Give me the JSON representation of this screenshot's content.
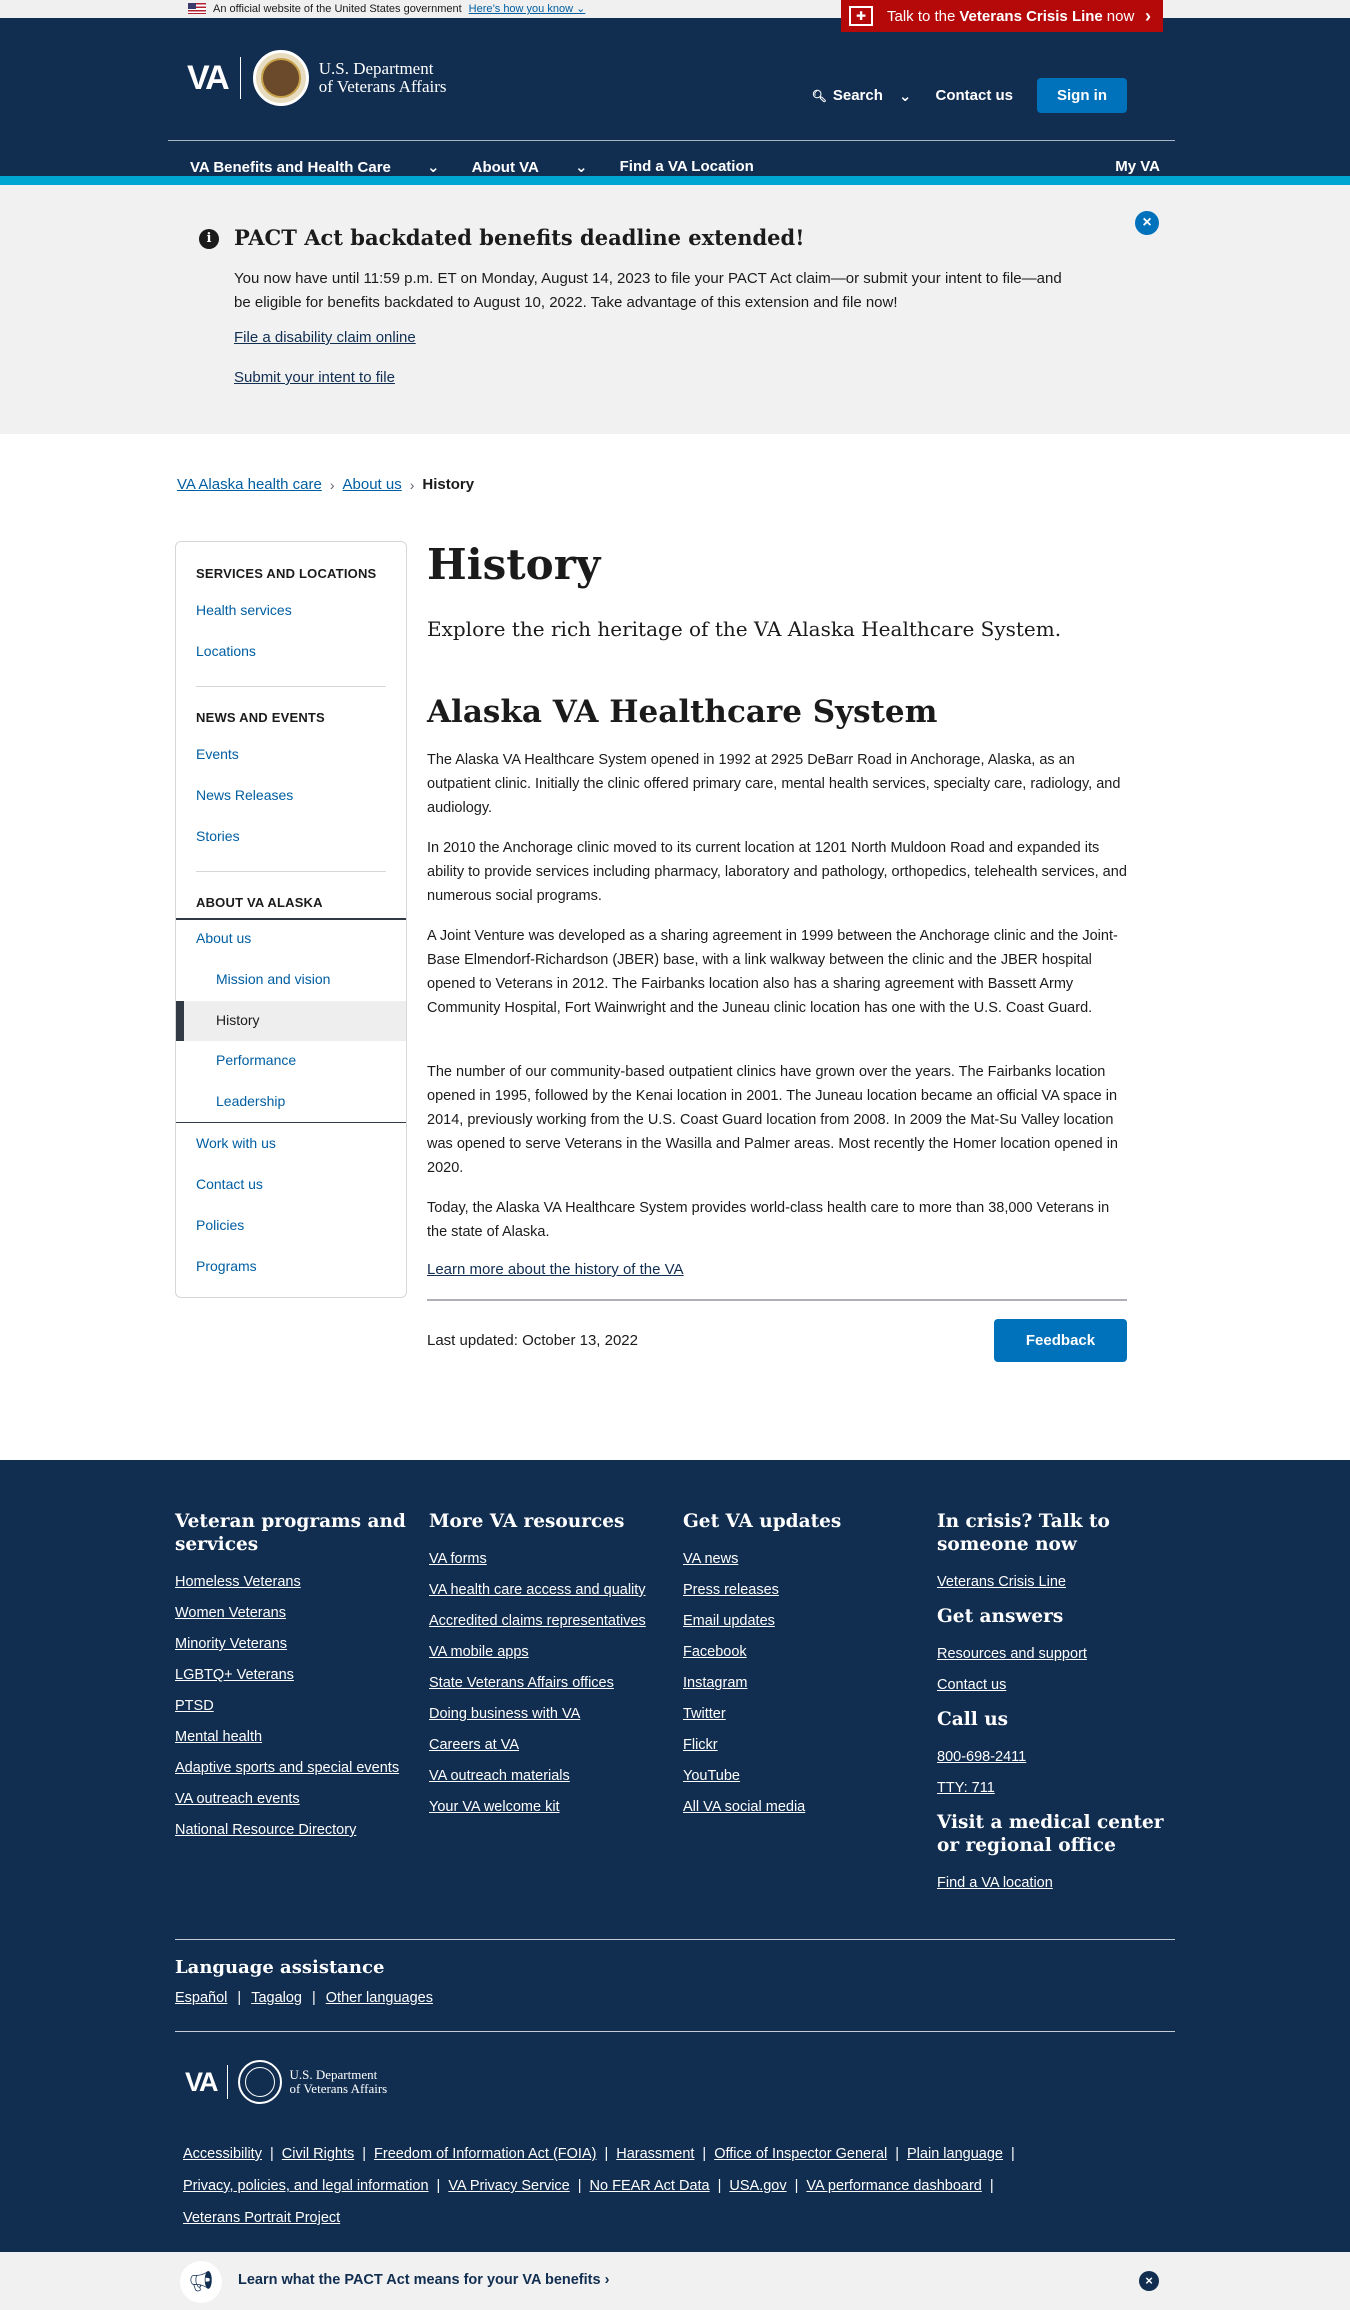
{
  "gov_banner": {
    "text": "An official website of the United States government",
    "link": "Here’s how you know"
  },
  "crisis_line": {
    "pre": "Talk to the",
    "bold": "Veterans Crisis Line",
    "post": "now"
  },
  "header": {
    "logo_text": "VA",
    "dept_line1": "U.S. Department",
    "dept_line2": "of Veterans Affairs",
    "search": "Search",
    "contact": "Contact us",
    "signin": "Sign in"
  },
  "nav": {
    "benefits": "VA Benefits and Health Care",
    "about": "About VA",
    "find": "Find a VA Location",
    "myva": "My VA"
  },
  "alert": {
    "title": "PACT Act backdated benefits deadline extended!",
    "body": "You now have until 11:59 p.m. ET on Monday, August 14, 2023 to file your PACT Act claim—or submit your intent to file—and be eligible for benefits backdated to August 10, 2022. Take advantage of this extension and file now!",
    "link1": "File a disability claim online",
    "link2": "Submit your intent to file"
  },
  "breadcrumb": {
    "c1": "VA Alaska health care",
    "c2": "About us",
    "c3": "History"
  },
  "sidebar": {
    "h1": "SERVICES AND LOCATIONS",
    "health_services": "Health services",
    "locations": "Locations",
    "h2": "NEWS AND EVENTS",
    "events": "Events",
    "news": "News Releases",
    "stories": "Stories",
    "h3": "ABOUT VA ALASKA",
    "about_us": "About us",
    "mission": "Mission and vision",
    "history": "History",
    "performance": "Performance",
    "leadership": "Leadership",
    "work": "Work with us",
    "contact": "Contact us",
    "policies": "Policies",
    "programs": "Programs"
  },
  "main": {
    "title": "History",
    "lead": "Explore the rich heritage of the VA Alaska Healthcare System.",
    "subtitle": "Alaska VA Healthcare System",
    "p1": "The Alaska VA Healthcare System opened in 1992 at 2925 DeBarr Road in Anchorage, Alaska, as an outpatient clinic. Initially the clinic offered primary care, mental health services, specialty care, radiology, and audiology.",
    "p2": "In 2010 the Anchorage clinic moved to its current location at 1201 North Muldoon Road and expanded its ability to provide services including pharmacy, laboratory and pathology, orthopedics, telehealth services, and numerous social programs.",
    "p3": "A Joint Venture was developed as a sharing agreement in 1999 between the Anchorage clinic and the Joint-Base Elmendorf-Richardson (JBER) base, with a link walkway between the clinic and the JBER hospital opened to Veterans in 2012. The Fairbanks location also has a sharing agreement with Bassett Army Community Hospital, Fort Wainwright and the Juneau clinic location has one with the U.S. Coast Guard.",
    "p4": "The number of our community-based outpatient clinics have grown over the years. The Fairbanks location opened in 1995, followed by the Kenai location in 2001. The Juneau location became an official VA space in 2014, previously working from the U.S. Coast Guard location from 2008. In 2009 the Mat-Su Valley location was opened to serve Veterans in the Wasilla and Palmer areas. Most recently the Homer location opened in 2020.",
    "p5": "Today, the Alaska VA Healthcare System provides world-class health care to more than 38,000 Veterans in the state of Alaska.",
    "learn_more": "Learn more about the history of the VA",
    "last_updated": "Last updated: October 13, 2022",
    "feedback": "Feedback"
  },
  "footer": {
    "col1_title": "Veteran programs and services",
    "col1": [
      "Homeless Veterans",
      "Women Veterans",
      "Minority Veterans",
      "LGBTQ+ Veterans",
      "PTSD",
      "Mental health",
      "Adaptive sports and special events",
      "VA outreach events",
      "National Resource Directory"
    ],
    "col2_title": "More VA resources",
    "col2": [
      "VA forms",
      "VA health care access and quality",
      "Accredited claims representatives",
      "VA mobile apps",
      "State Veterans Affairs offices",
      "Doing business with VA",
      "Careers at VA",
      "VA outreach materials",
      "Your VA welcome kit"
    ],
    "col3_title": "Get VA updates",
    "col3": [
      "VA news",
      "Press releases",
      "Email updates",
      "Facebook",
      "Instagram",
      "Twitter",
      "Flickr",
      "YouTube",
      "All VA social media"
    ],
    "crisis_title": "In crisis? Talk to someone now",
    "crisis_link": "Veterans Crisis Line",
    "answers_title": "Get answers",
    "answers1": "Resources and support",
    "answers2": "Contact us",
    "call_title": "Call us",
    "phone": "800-698-2411",
    "tty": "TTY: 711",
    "visit_title": "Visit a medical center or regional office",
    "visit_link": "Find a VA location",
    "lang_title": "Language assistance",
    "lang1": "Español",
    "lang2": "Tagalog",
    "lang3": "Other languages",
    "logo_text": "VA",
    "dept_line1": "U.S. Department",
    "dept_line2": "of Veterans Affairs",
    "legal": [
      "Accessibility",
      "Civil Rights",
      "Freedom of Information Act (FOIA)",
      "Harassment",
      "Office of Inspector General",
      "Plain language",
      "Privacy, policies, and legal information",
      "VA Privacy Service",
      "No FEAR Act Data",
      "USA.gov",
      "VA performance dashboard",
      "Veterans Portrait Project"
    ]
  },
  "promo": {
    "text": "Learn what the PACT Act means for your VA benefits"
  }
}
